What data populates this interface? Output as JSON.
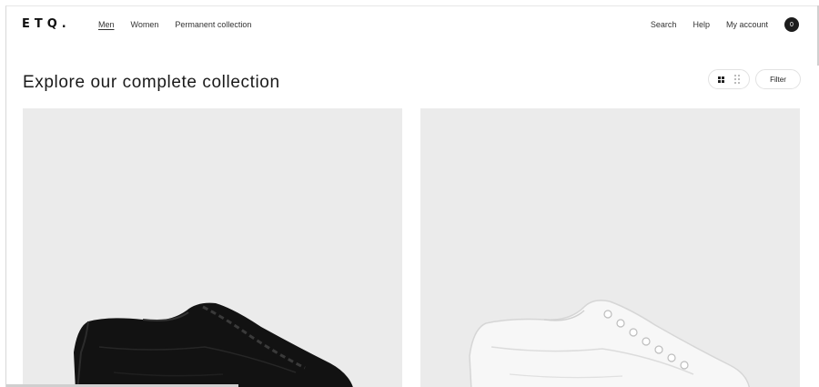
{
  "brand": {
    "logo": "ETQ."
  },
  "nav": {
    "primary": [
      {
        "label": "Men",
        "active": true
      },
      {
        "label": "Women",
        "active": false
      },
      {
        "label": "Permanent collection",
        "active": false
      }
    ],
    "secondary": {
      "search": "Search",
      "help": "Help",
      "account": "My account",
      "cart_count": "0"
    }
  },
  "page": {
    "title": "Explore our complete collection",
    "filter_label": "Filter"
  },
  "products": [
    {
      "name": "black-sneaker",
      "color": "#111111"
    },
    {
      "name": "white-sneaker",
      "color": "#f6f6f6"
    }
  ],
  "colors": {
    "background": "#ffffff",
    "card": "#ebebeb",
    "accent": "#1c1c1c"
  }
}
